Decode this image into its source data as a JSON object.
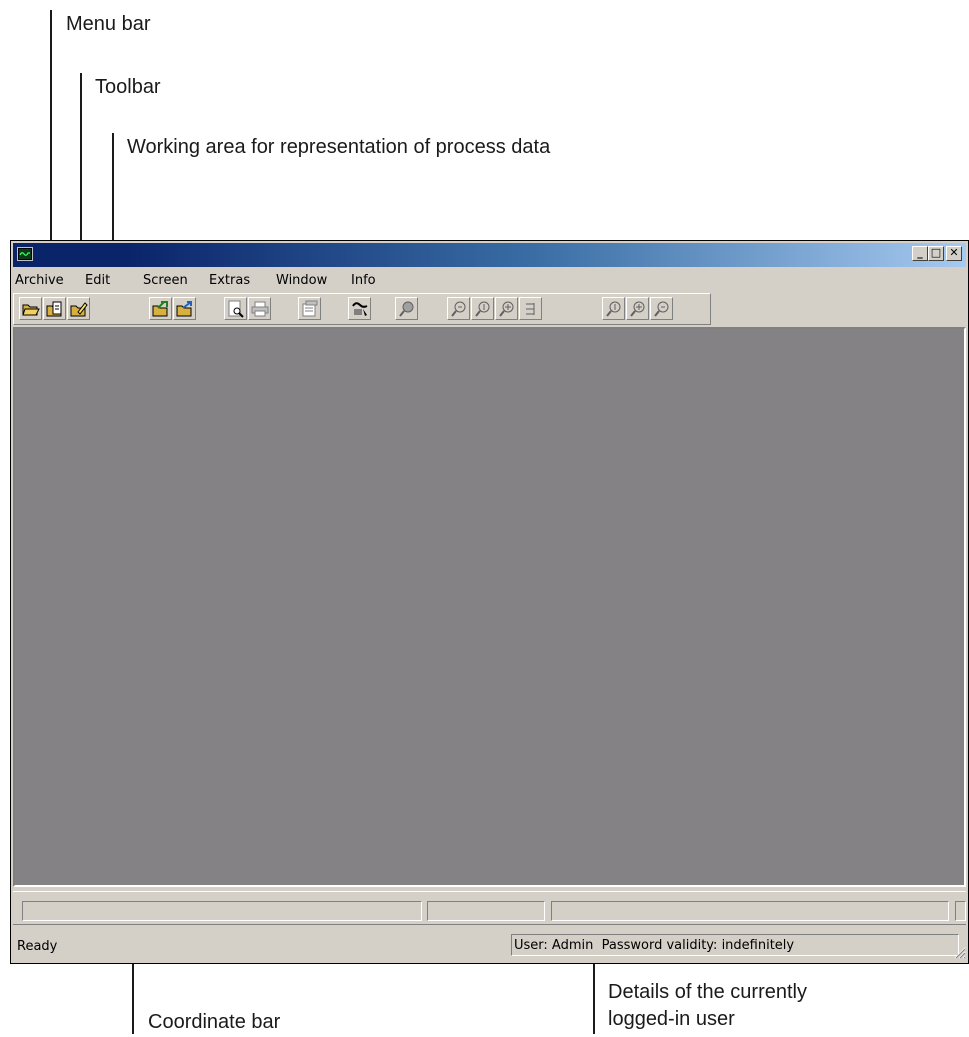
{
  "annotations": {
    "menu_bar": "Menu bar",
    "toolbar": "Toolbar",
    "working_area": "Working area for representation of process data",
    "coordinate_bar": "Coordinate bar",
    "user_details_line1": "Details of the currently",
    "user_details_line2": "logged-in user"
  },
  "window": {
    "title": "",
    "controls": {
      "minimize": "_",
      "maximize": "□",
      "close": "✕"
    }
  },
  "menu": [
    "Archive",
    "Edit",
    "Screen",
    "Extras",
    "Window",
    "Info"
  ],
  "toolbar": {
    "icons": [
      "open-folder-icon",
      "open-file-icon",
      "edit-file-icon",
      "import-folder-icon",
      "export-folder-icon",
      "print-preview-icon",
      "print-icon",
      "properties-icon",
      "marker-icon",
      "zoom-icon",
      "zoom-out-icon",
      "zoom-x-icon",
      "zoom-y-icon",
      "cursor-line-icon",
      "zoom-in-x-icon",
      "zoom-in-icon",
      "zoom-reset-icon"
    ]
  },
  "status": {
    "text": "Ready",
    "user_info": "User: Admin  Password validity: indefinitely"
  },
  "colors": {
    "title_gradient_start": "#0a246a",
    "title_gradient_end": "#a6caf0",
    "face": "#d4d0c8",
    "workspace": "#858285"
  }
}
